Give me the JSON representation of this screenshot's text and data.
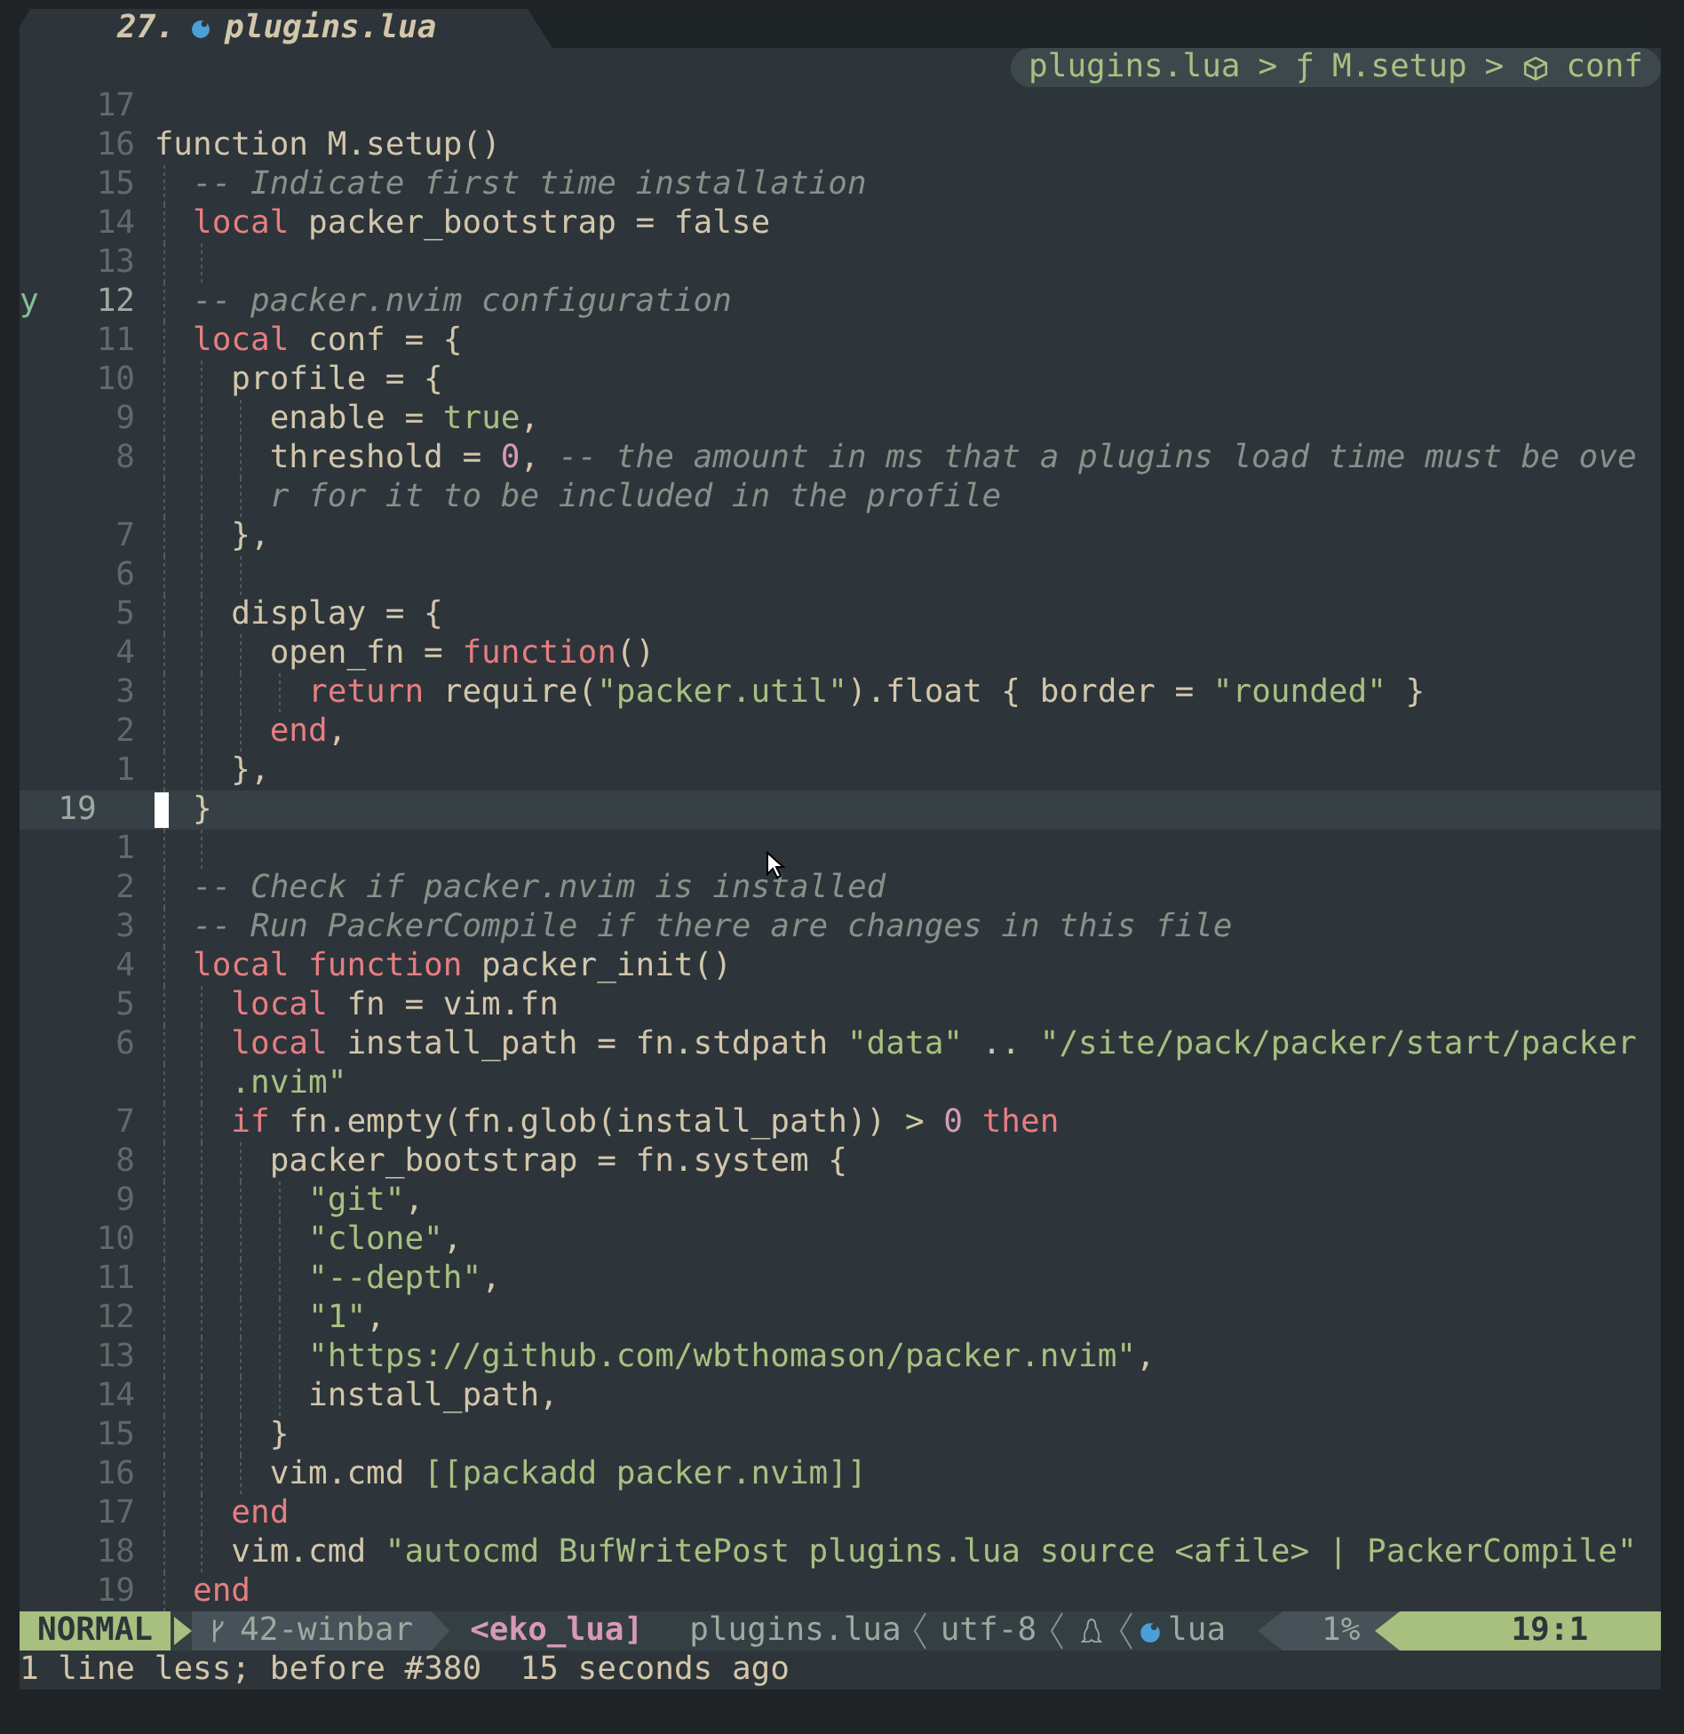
{
  "tab": {
    "number": "27.",
    "title": "plugins.lua"
  },
  "winbar": {
    "separator": ">",
    "crumbs": [
      {
        "kind": "file",
        "text": "plugins.lua"
      },
      {
        "kind": "function",
        "symbol": "ƒ",
        "text": "M.setup"
      },
      {
        "kind": "object",
        "text": "conf"
      }
    ]
  },
  "lines": [
    {
      "num": "17"
    },
    {
      "num": "16",
      "tokens": [
        {
          "kind": "plain",
          "text": "function M.setup()"
        }
      ]
    },
    {
      "num": "15",
      "tokens": [
        {
          "kind": "comment",
          "text": "  -- Indicate first time installation"
        }
      ]
    },
    {
      "num": "14",
      "tokens": [
        {
          "kind": "kw",
          "text": "  local"
        },
        {
          "kind": "plain",
          "text": " packer_bootstrap = false"
        }
      ]
    },
    {
      "num": "13"
    },
    {
      "num": "12",
      "sign": "y",
      "tokens": [
        {
          "kind": "comment",
          "text": "  -- packer.nvim configuration"
        }
      ]
    },
    {
      "num": "11",
      "tokens": [
        {
          "kind": "kw",
          "text": "  local"
        },
        {
          "kind": "plain",
          "text": " conf = {"
        }
      ]
    },
    {
      "num": "10",
      "tokens": [
        {
          "kind": "plain",
          "text": "    profile = {"
        }
      ]
    },
    {
      "num": "9",
      "tokens": [
        {
          "kind": "plain",
          "text": "      enable = "
        },
        {
          "kind": "bool",
          "text": "true"
        },
        {
          "kind": "plain",
          "text": ","
        }
      ]
    },
    {
      "num": "8",
      "tokens": [
        {
          "kind": "plain",
          "text": "      threshold = "
        },
        {
          "kind": "num",
          "text": "0"
        },
        {
          "kind": "plain",
          "text": ", "
        },
        {
          "kind": "comment",
          "text": "-- the amount in ms that a plugins load time must be ove"
        }
      ]
    },
    {
      "tokens": [
        {
          "kind": "comment",
          "text": "      r for it to be included in the profile"
        }
      ]
    },
    {
      "num": "7",
      "tokens": [
        {
          "kind": "plain",
          "text": "    },"
        }
      ]
    },
    {
      "num": "6"
    },
    {
      "num": "5",
      "tokens": [
        {
          "kind": "plain",
          "text": "    display = {"
        }
      ]
    },
    {
      "num": "4",
      "tokens": [
        {
          "kind": "plain",
          "text": "      open_fn = "
        },
        {
          "kind": "kw",
          "text": "function"
        },
        {
          "kind": "plain",
          "text": "()"
        }
      ]
    },
    {
      "num": "3",
      "tokens": [
        {
          "kind": "kw",
          "text": "        return"
        },
        {
          "kind": "plain",
          "text": " require("
        },
        {
          "kind": "str",
          "text": "\"packer.util\""
        },
        {
          "kind": "plain",
          "text": ").float { border = "
        },
        {
          "kind": "str",
          "text": "\"rounded\""
        },
        {
          "kind": "plain",
          "text": " }"
        }
      ]
    },
    {
      "num": "2",
      "tokens": [
        {
          "kind": "kw",
          "text": "      end"
        },
        {
          "kind": "plain",
          "text": ","
        }
      ]
    },
    {
      "num": "1",
      "tokens": [
        {
          "kind": "plain",
          "text": "    },"
        }
      ]
    },
    {
      "num": "19",
      "current": true,
      "tokens": [
        {
          "kind": "plain",
          "text": "  }"
        }
      ]
    },
    {
      "num": "1"
    },
    {
      "num": "2",
      "tokens": [
        {
          "kind": "comment",
          "text": "  -- Check if packer.nvim is installed"
        }
      ]
    },
    {
      "num": "3",
      "tokens": [
        {
          "kind": "comment",
          "text": "  -- Run PackerCompile if there are changes in this file"
        }
      ]
    },
    {
      "num": "4",
      "tokens": [
        {
          "kind": "kw",
          "text": "  local function"
        },
        {
          "kind": "plain",
          "text": " packer_init()"
        }
      ]
    },
    {
      "num": "5",
      "tokens": [
        {
          "kind": "kw",
          "text": "    local"
        },
        {
          "kind": "plain",
          "text": " fn = vim.fn"
        }
      ]
    },
    {
      "num": "6",
      "tokens": [
        {
          "kind": "kw",
          "text": "    local"
        },
        {
          "kind": "plain",
          "text": " install_path = fn.stdpath "
        },
        {
          "kind": "str",
          "text": "\"data\""
        },
        {
          "kind": "plain",
          "text": " .. "
        },
        {
          "kind": "str",
          "text": "\"/site/pack/packer/start/packer"
        }
      ]
    },
    {
      "tokens": [
        {
          "kind": "str",
          "text": "    .nvim\""
        }
      ]
    },
    {
      "num": "7",
      "tokens": [
        {
          "kind": "kw",
          "text": "    if"
        },
        {
          "kind": "plain",
          "text": " fn.empty(fn.glob(install_path)) > "
        },
        {
          "kind": "num",
          "text": "0"
        },
        {
          "kind": "kw",
          "text": " then"
        }
      ]
    },
    {
      "num": "8",
      "tokens": [
        {
          "kind": "plain",
          "text": "      packer_bootstrap = fn.system {"
        }
      ]
    },
    {
      "num": "9",
      "tokens": [
        {
          "kind": "str",
          "text": "        \"git\""
        },
        {
          "kind": "plain",
          "text": ","
        }
      ]
    },
    {
      "num": "10",
      "tokens": [
        {
          "kind": "str",
          "text": "        \"clone\""
        },
        {
          "kind": "plain",
          "text": ","
        }
      ]
    },
    {
      "num": "11",
      "tokens": [
        {
          "kind": "str",
          "text": "        \"--depth\""
        },
        {
          "kind": "plain",
          "text": ","
        }
      ]
    },
    {
      "num": "12",
      "tokens": [
        {
          "kind": "str",
          "text": "        \"1\""
        },
        {
          "kind": "plain",
          "text": ","
        }
      ]
    },
    {
      "num": "13",
      "tokens": [
        {
          "kind": "str",
          "text": "        \"https://github.com/wbthomason/packer.nvim\""
        },
        {
          "kind": "plain",
          "text": ","
        }
      ]
    },
    {
      "num": "14",
      "tokens": [
        {
          "kind": "plain",
          "text": "        install_path,"
        }
      ]
    },
    {
      "num": "15",
      "tokens": [
        {
          "kind": "plain",
          "text": "      }"
        }
      ]
    },
    {
      "num": "16",
      "tokens": [
        {
          "kind": "plain",
          "text": "      vim.cmd "
        },
        {
          "kind": "str",
          "text": "[[packadd packer.nvim]]"
        }
      ]
    },
    {
      "num": "17",
      "tokens": [
        {
          "kind": "kw",
          "text": "    end"
        }
      ]
    },
    {
      "num": "18",
      "tokens": [
        {
          "kind": "plain",
          "text": "    vim.cmd "
        },
        {
          "kind": "str",
          "text": "\"autocmd BufWritePost plugins.lua source <afile> | PackerCompile\""
        }
      ]
    },
    {
      "num": "19",
      "tokens": [
        {
          "kind": "kw",
          "text": "  end"
        }
      ]
    }
  ],
  "statusline": {
    "mode": "NORMAL",
    "branch": "42-winbar",
    "project": "<eko_lua]",
    "file": "plugins.lua",
    "encoding": "utf-8",
    "filetype": "lua",
    "percent": "1%",
    "position": "19:1"
  },
  "message": "1 line less; before #380  15 seconds ago"
}
